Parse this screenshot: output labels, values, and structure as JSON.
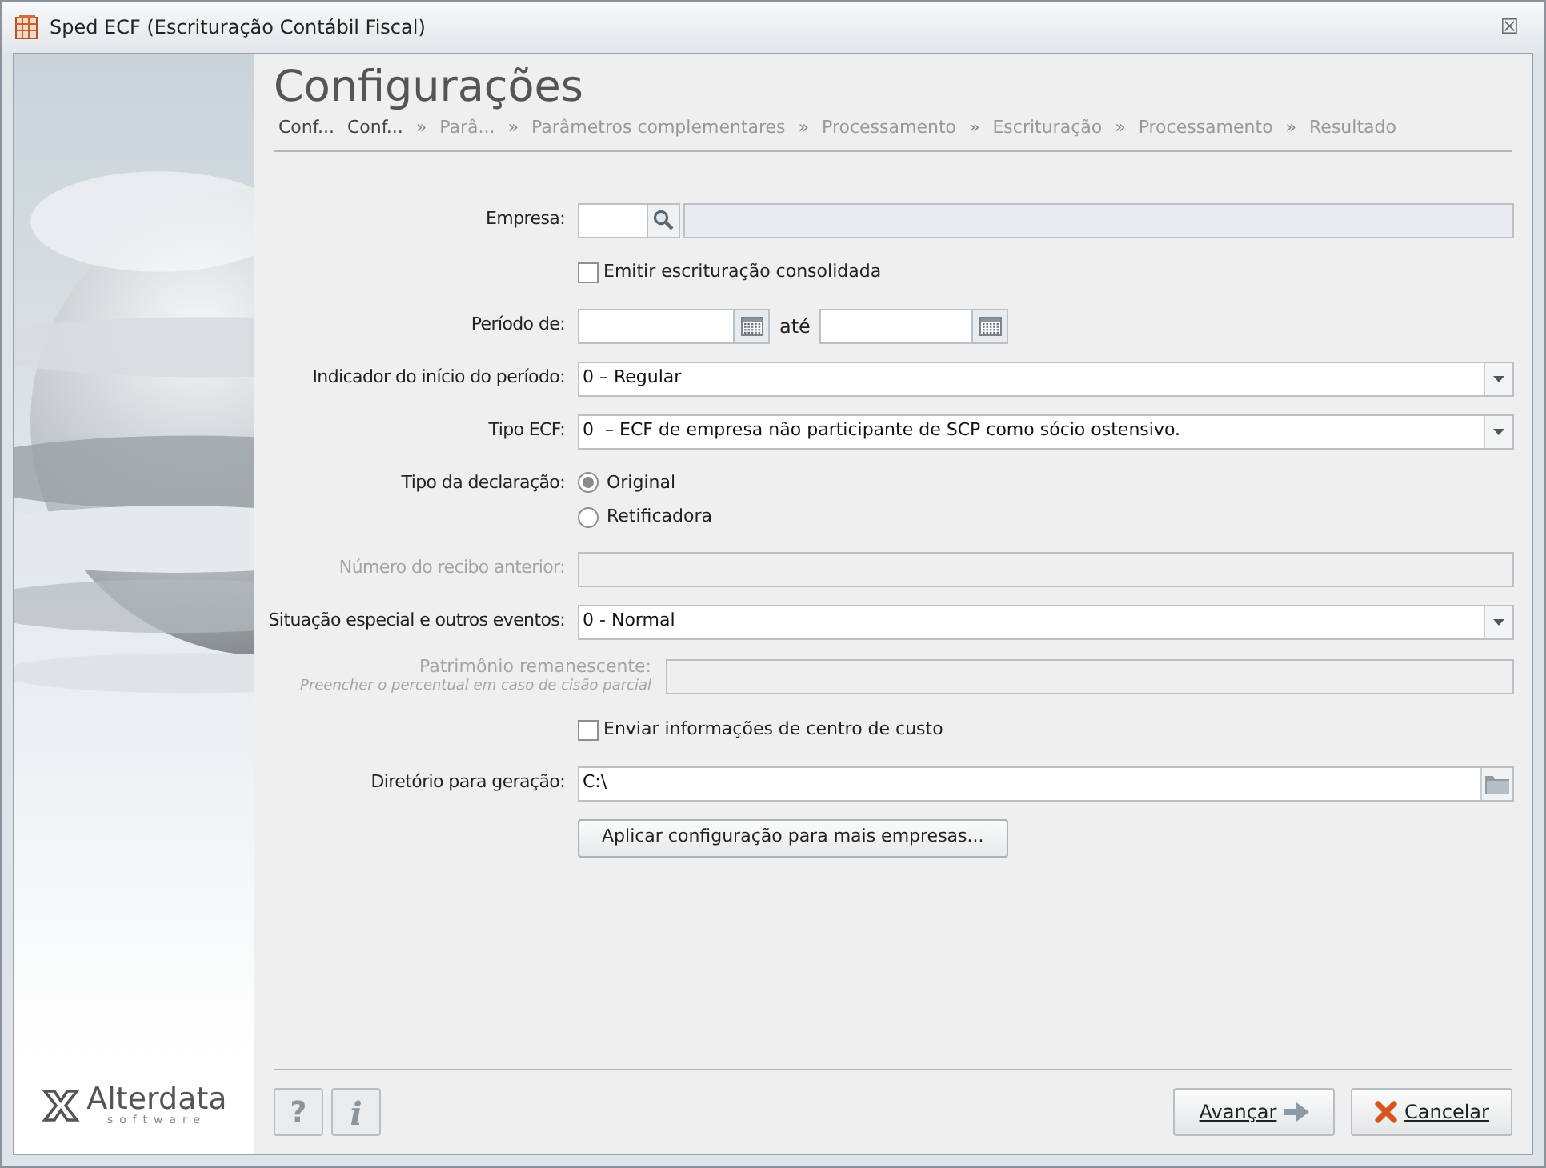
{
  "window": {
    "title": "Sped ECF (Escrituração Contábil Fiscal)",
    "close": "☒"
  },
  "header": {
    "title": "Configurações",
    "steps": [
      {
        "label": "Conf...",
        "active": true
      },
      {
        "label": "Conf...",
        "active": true
      },
      {
        "label": "Parâ...",
        "separator": "»",
        "active": false
      },
      {
        "label": "Parâmetros complementares",
        "separator": "»",
        "active": false
      },
      {
        "label": "Processamento",
        "separator": "»",
        "active": false
      },
      {
        "label": "Escrituração",
        "separator": "»",
        "active": false
      },
      {
        "label": "Processamento",
        "separator": "»",
        "active": false
      },
      {
        "label": "Resultado",
        "separator": "»",
        "active": false
      }
    ]
  },
  "form": [
    {
      "kind": "lookup",
      "label": "Empresa:",
      "disabled": false
    },
    {
      "kind": "checkbox",
      "text": "Emitir escrituração consolidada",
      "checked": false
    },
    {
      "kind": "date_range",
      "label": "Período de:",
      "between": "até"
    },
    {
      "kind": "select",
      "label": "Indicador do início do período:",
      "value": "0 – Regular"
    },
    {
      "kind": "select",
      "label": "Tipo ECF:",
      "value": "0  – ECF de empresa não participante de SCP como sócio ostensivo."
    },
    {
      "kind": "radio",
      "label": "Tipo da declaração:",
      "options": [
        {
          "label": "Original",
          "selected": true
        },
        {
          "label": "Retificadora",
          "selected": false
        }
      ]
    },
    {
      "kind": "text",
      "label": "Número do recibo anterior:",
      "disabled": true
    },
    {
      "kind": "select",
      "label": "Situação especial e outros eventos:",
      "value": "0 - Normal"
    },
    {
      "kind": "two_line_text",
      "label": "Patrimônio remanescente:",
      "hint": "Preencher o percentual em caso de cisão parcial",
      "disabled": true
    },
    {
      "kind": "checkbox",
      "text": "Enviar informações de centro de custo",
      "checked": false
    },
    {
      "kind": "path",
      "label": "Diretório para geração:",
      "value": "C:\\"
    },
    {
      "kind": "button",
      "text": "Aplicar configuração para mais empresas..."
    }
  ],
  "logo": {
    "name": "Alterdata",
    "tagline": "software"
  },
  "footer": {
    "help": "?",
    "info": "i",
    "next": "Avançar",
    "cancel": "Cancelar"
  }
}
